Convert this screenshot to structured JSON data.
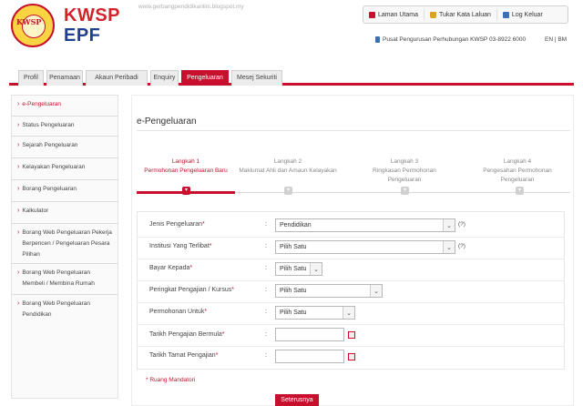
{
  "header": {
    "logo_text": "KWSP",
    "brand_line1": "KWSP",
    "brand_line2": "EPF",
    "watermark": "www.gerbangpendidikanlini.blogspot.my",
    "links": [
      {
        "label": "Laman Utama",
        "icon": "home-icon"
      },
      {
        "label": "Tukar Kata Laluan",
        "icon": "lock-icon"
      },
      {
        "label": "Log Keluar",
        "icon": "logout-icon"
      }
    ],
    "contact": "Pusat Pengurusan Perhubungan KWSP 03-8922 6000",
    "lang": "EN | BM"
  },
  "tabs": [
    {
      "label": "Profil"
    },
    {
      "label": "Penamaan"
    },
    {
      "label": "Akaun Peribadi"
    },
    {
      "label": "Enquiry"
    },
    {
      "label": "Pengeluaran"
    },
    {
      "label": "Mesej Sekuriti"
    }
  ],
  "sidebar": {
    "items": [
      {
        "label": "e-Pengeluaran"
      },
      {
        "label": "Status Pengeluaran"
      },
      {
        "label": "Sejarah Pengeluaran"
      },
      {
        "label": "Kelayakan Pengeluaran"
      },
      {
        "label": "Borang Pengeluaran"
      },
      {
        "label": "Kalkulator"
      },
      {
        "label": "Borang Web Pengeluaran Pekerja Berpencen / Pengeluaran Pesara Pilihan"
      },
      {
        "label": "Borang Web Pengeluaran Membeli / Membina Rumah"
      },
      {
        "label": "Borang Web Pengeluaran Pendidikan"
      }
    ]
  },
  "main": {
    "title": "e-Pengeluaran",
    "steps": [
      {
        "number": "Langkah 1",
        "label": "Permohonan Pengeluaran Baru"
      },
      {
        "number": "Langkah 2",
        "label": "Maklumat Ahli dan Amaun Kelayakan"
      },
      {
        "number": "Langkah 3",
        "label": "Ringkasan Permohonan Pengeluaran"
      },
      {
        "number": "Langkah 4",
        "label": "Pengesahan Permohonan Pengeluaran"
      }
    ],
    "form": {
      "colon": ":",
      "required_mark": "*",
      "fields": [
        {
          "label": "Jenis Pengeluaran",
          "value": "Pendidikan",
          "help": "(?)"
        },
        {
          "label": "Institusi Yang Terlibat",
          "value": "Pilih Satu",
          "help": "(?)"
        },
        {
          "label": "Bayar Kepada",
          "value": "Pilih Satu"
        },
        {
          "label": "Peringkat Pengajian / Kursus",
          "value": "Pilih Satu"
        },
        {
          "label": "Permohonan Untuk",
          "value": "Pilih Satu"
        },
        {
          "label": "Tarikh Pengajian Bermula",
          "value": ""
        },
        {
          "label": "Tarikh Tamat Pengajian",
          "value": ""
        }
      ]
    },
    "mandatory_note": "* Ruang Mandatori",
    "submit_label": "Seterusnya"
  },
  "colors": {
    "accent": "#c8102e",
    "brand_blue": "#1f3f8f"
  }
}
